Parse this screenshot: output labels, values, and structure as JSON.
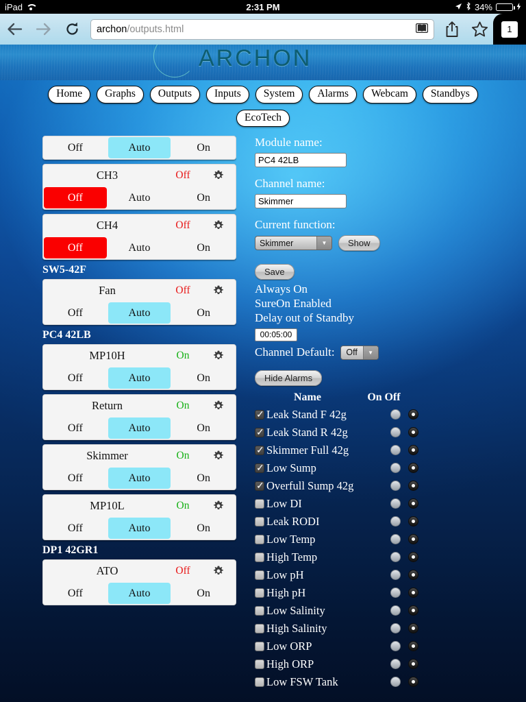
{
  "status_bar": {
    "device": "iPad",
    "wifi_icon": "wifi-icon",
    "time": "2:31 PM",
    "location_icon": "location-arrow-icon",
    "bluetooth_icon": "bluetooth-icon",
    "battery_percent": "34%",
    "battery_level": 34,
    "charging_icon": "lightning-bolt-icon"
  },
  "browser": {
    "back_icon": "back-arrow-icon",
    "forward_icon": "forward-arrow-icon",
    "reload_icon": "reload-icon",
    "url_host": "archon",
    "url_path": "/outputs.html",
    "reader_icon": "reader-view-icon",
    "share_icon": "share-icon",
    "bookmark_icon": "bookmark-star-icon",
    "tab_count": "1"
  },
  "site": {
    "logo_text": "ARCHON",
    "nav_primary": [
      "Home",
      "Graphs",
      "Outputs",
      "Inputs",
      "System",
      "Alarms",
      "Webcam",
      "Standbys"
    ],
    "nav_secondary": [
      "EcoTech"
    ]
  },
  "outputs": {
    "groups": [
      {
        "label": "",
        "channels": [
          {
            "name": "",
            "state": "",
            "state_color": "",
            "clipped_top": true,
            "gear_icon": "gear-icon",
            "buttons": [
              "Off",
              "Auto",
              "On"
            ],
            "selected": "Auto"
          },
          {
            "name": "CH3",
            "state": "Off",
            "state_color": "off",
            "gear_icon": "gear-icon",
            "buttons": [
              "Off",
              "Auto",
              "On"
            ],
            "selected": "Off"
          },
          {
            "name": "CH4",
            "state": "Off",
            "state_color": "off",
            "gear_icon": "gear-icon",
            "buttons": [
              "Off",
              "Auto",
              "On"
            ],
            "selected": "Off"
          }
        ]
      },
      {
        "label": "SW5-42F",
        "channels": [
          {
            "name": "Fan",
            "state": "Off",
            "state_color": "off",
            "gear_icon": "gear-icon",
            "buttons": [
              "Off",
              "Auto",
              "On"
            ],
            "selected": "Auto"
          }
        ]
      },
      {
        "label": "PC4 42LB",
        "channels": [
          {
            "name": "MP10H",
            "state": "On",
            "state_color": "on",
            "gear_icon": "gear-icon",
            "buttons": [
              "Off",
              "Auto",
              "On"
            ],
            "selected": "Auto"
          },
          {
            "name": "Return",
            "state": "On",
            "state_color": "on",
            "gear_icon": "gear-icon",
            "buttons": [
              "Off",
              "Auto",
              "On"
            ],
            "selected": "Auto"
          },
          {
            "name": "Skimmer",
            "state": "On",
            "state_color": "on",
            "gear_icon": "gear-icon",
            "buttons": [
              "Off",
              "Auto",
              "On"
            ],
            "selected": "Auto"
          },
          {
            "name": "MP10L",
            "state": "On",
            "state_color": "on",
            "gear_icon": "gear-icon",
            "buttons": [
              "Off",
              "Auto",
              "On"
            ],
            "selected": "Auto"
          }
        ]
      },
      {
        "label": "DP1 42GR1",
        "channels": [
          {
            "name": "ATO",
            "state": "Off",
            "state_color": "off",
            "gear_icon": "gear-icon",
            "buttons": [
              "Off",
              "Auto",
              "On"
            ],
            "selected": "Auto",
            "clipped_bottom": true
          }
        ]
      }
    ]
  },
  "detail": {
    "module_name_label": "Module name:",
    "module_name_value": "PC4 42LB",
    "channel_name_label": "Channel name:",
    "channel_name_value": "Skimmer",
    "current_function_label": "Current function:",
    "current_function_value": "Skimmer",
    "show_button": "Show",
    "save_button": "Save",
    "flags": [
      "Always On",
      "SureOn Enabled",
      "Delay out of Standby"
    ],
    "delay_value": "00:05:00",
    "channel_default_label": "Channel Default:",
    "channel_default_value": "Off",
    "hide_alarms_button": "Hide Alarms"
  },
  "alarms": {
    "col_name": "Name",
    "col_on": "On",
    "col_off": "Off",
    "rows": [
      {
        "name": "Leak Stand F 42g",
        "enabled": true,
        "trigger": "Off"
      },
      {
        "name": "Leak Stand R 42g",
        "enabled": true,
        "trigger": "Off"
      },
      {
        "name": "Skimmer Full 42g",
        "enabled": true,
        "trigger": "Off"
      },
      {
        "name": "Low Sump",
        "enabled": true,
        "trigger": "Off"
      },
      {
        "name": "Overfull Sump 42g",
        "enabled": true,
        "trigger": "Off"
      },
      {
        "name": "Low DI",
        "enabled": false,
        "trigger": "Off"
      },
      {
        "name": "Leak RODI",
        "enabled": false,
        "trigger": "Off"
      },
      {
        "name": "Low Temp",
        "enabled": false,
        "trigger": "Off"
      },
      {
        "name": "High Temp",
        "enabled": false,
        "trigger": "Off"
      },
      {
        "name": "Low pH",
        "enabled": false,
        "trigger": "Off"
      },
      {
        "name": "High pH",
        "enabled": false,
        "trigger": "Off"
      },
      {
        "name": "Low Salinity",
        "enabled": false,
        "trigger": "Off"
      },
      {
        "name": "High Salinity",
        "enabled": false,
        "trigger": "Off"
      },
      {
        "name": "Low ORP",
        "enabled": false,
        "trigger": "Off"
      },
      {
        "name": "High ORP",
        "enabled": false,
        "trigger": "Off"
      },
      {
        "name": "Low FSW Tank",
        "enabled": false,
        "trigger": "Off"
      }
    ]
  },
  "colors": {
    "selected_auto": "#8ce7f8",
    "selected_off": "#fa0000",
    "state_on": "#18b218",
    "state_off": "#e81818",
    "page_blue": "#0b3f87",
    "battery_green": "#4cd34c"
  }
}
